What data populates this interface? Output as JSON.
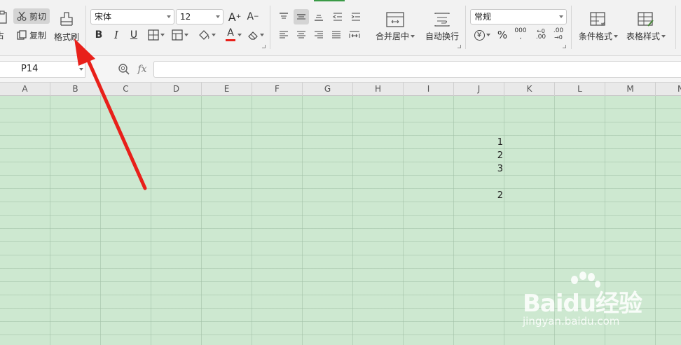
{
  "ribbon": {
    "clipboard": {
      "cut_label": "剪切",
      "copy_label": "复制",
      "format_painter_label": "格式刷",
      "paste_partial_label": "占"
    },
    "font": {
      "font_name": "宋体",
      "font_size": "12",
      "bold": "B",
      "italic": "I",
      "underline": "U",
      "font_color_glyph": "A"
    },
    "alignment": {
      "merge_center_label": "合并居中",
      "wrap_text_label": "自动换行"
    },
    "number": {
      "format_value": "常规",
      "currency_glyph": "¥",
      "percent_glyph": "%",
      "thousands_glyph": "000",
      "inc_decimal_glyph": ".00",
      "dec_decimal_glyph": ".00"
    },
    "styles": {
      "conditional_format_label": "条件格式",
      "table_style_label": "表格样式"
    }
  },
  "formula_bar": {
    "name_box_value": "P14",
    "fx_label": "fx",
    "formula_value": ""
  },
  "sheet": {
    "columns": [
      "A",
      "B",
      "C",
      "D",
      "E",
      "F",
      "G",
      "H",
      "I",
      "J",
      "K",
      "L",
      "M",
      "N"
    ],
    "cells": {
      "J4": "1",
      "J5": "2",
      "J6": "3",
      "J8": "2"
    }
  },
  "watermark": {
    "brand": "Baidu经验",
    "url": "jingyan.baidu.com"
  },
  "annotation": {
    "arrow_color": "#e8201a"
  }
}
